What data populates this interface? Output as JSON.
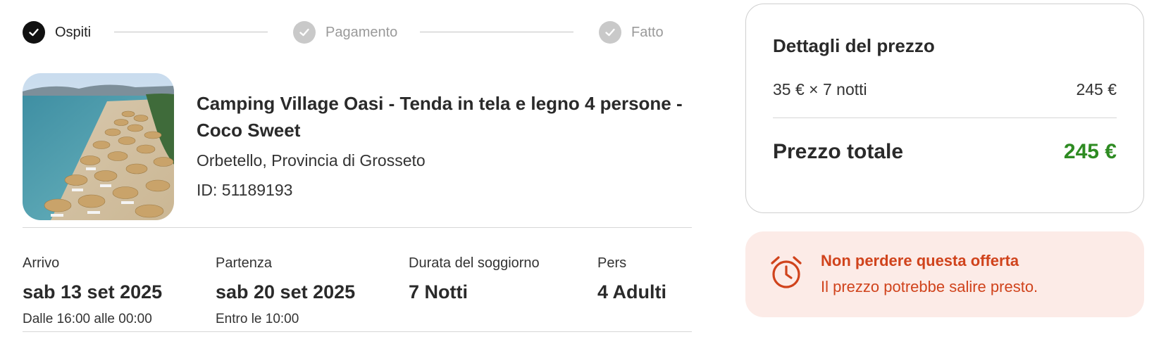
{
  "stepper": {
    "steps": [
      {
        "label": "Ospiti",
        "state": "active"
      },
      {
        "label": "Pagamento",
        "state": "inactive"
      },
      {
        "label": "Fatto",
        "state": "inactive"
      }
    ]
  },
  "listing": {
    "title": "Camping Village Oasi - Tenda in tela e legno 4 persone - Coco Sweet",
    "location": "Orbetello, Provincia di Grosseto",
    "id": "ID: 51189193",
    "image_icon": "beach-photo"
  },
  "details": {
    "arrival": {
      "label": "Arrivo",
      "value": "sab 13 set 2025",
      "sub": "Dalle 16:00 alle 00:00"
    },
    "departure": {
      "label": "Partenza",
      "value": "sab 20 set 2025",
      "sub": "Entro le 10:00"
    },
    "duration": {
      "label": "Durata del soggiorno",
      "value": "7 Notti"
    },
    "guests": {
      "label": "Pers",
      "value": "4 Adulti"
    }
  },
  "price": {
    "title": "Dettagli del prezzo",
    "line_label": "35 € × 7 notti",
    "line_value": "245 €",
    "total_label": "Prezzo totale",
    "total_value": "245 €"
  },
  "offer": {
    "title": "Non perdere questa offerta",
    "subtitle": "Il prezzo potrebbe salire presto.",
    "icon": "alarm-clock-icon"
  },
  "colors": {
    "active_step": "#111111",
    "inactive_step": "#c9c9c9",
    "total_green": "#2e8b22",
    "offer_text": "#d0431c",
    "offer_bg": "#fcebe7"
  }
}
